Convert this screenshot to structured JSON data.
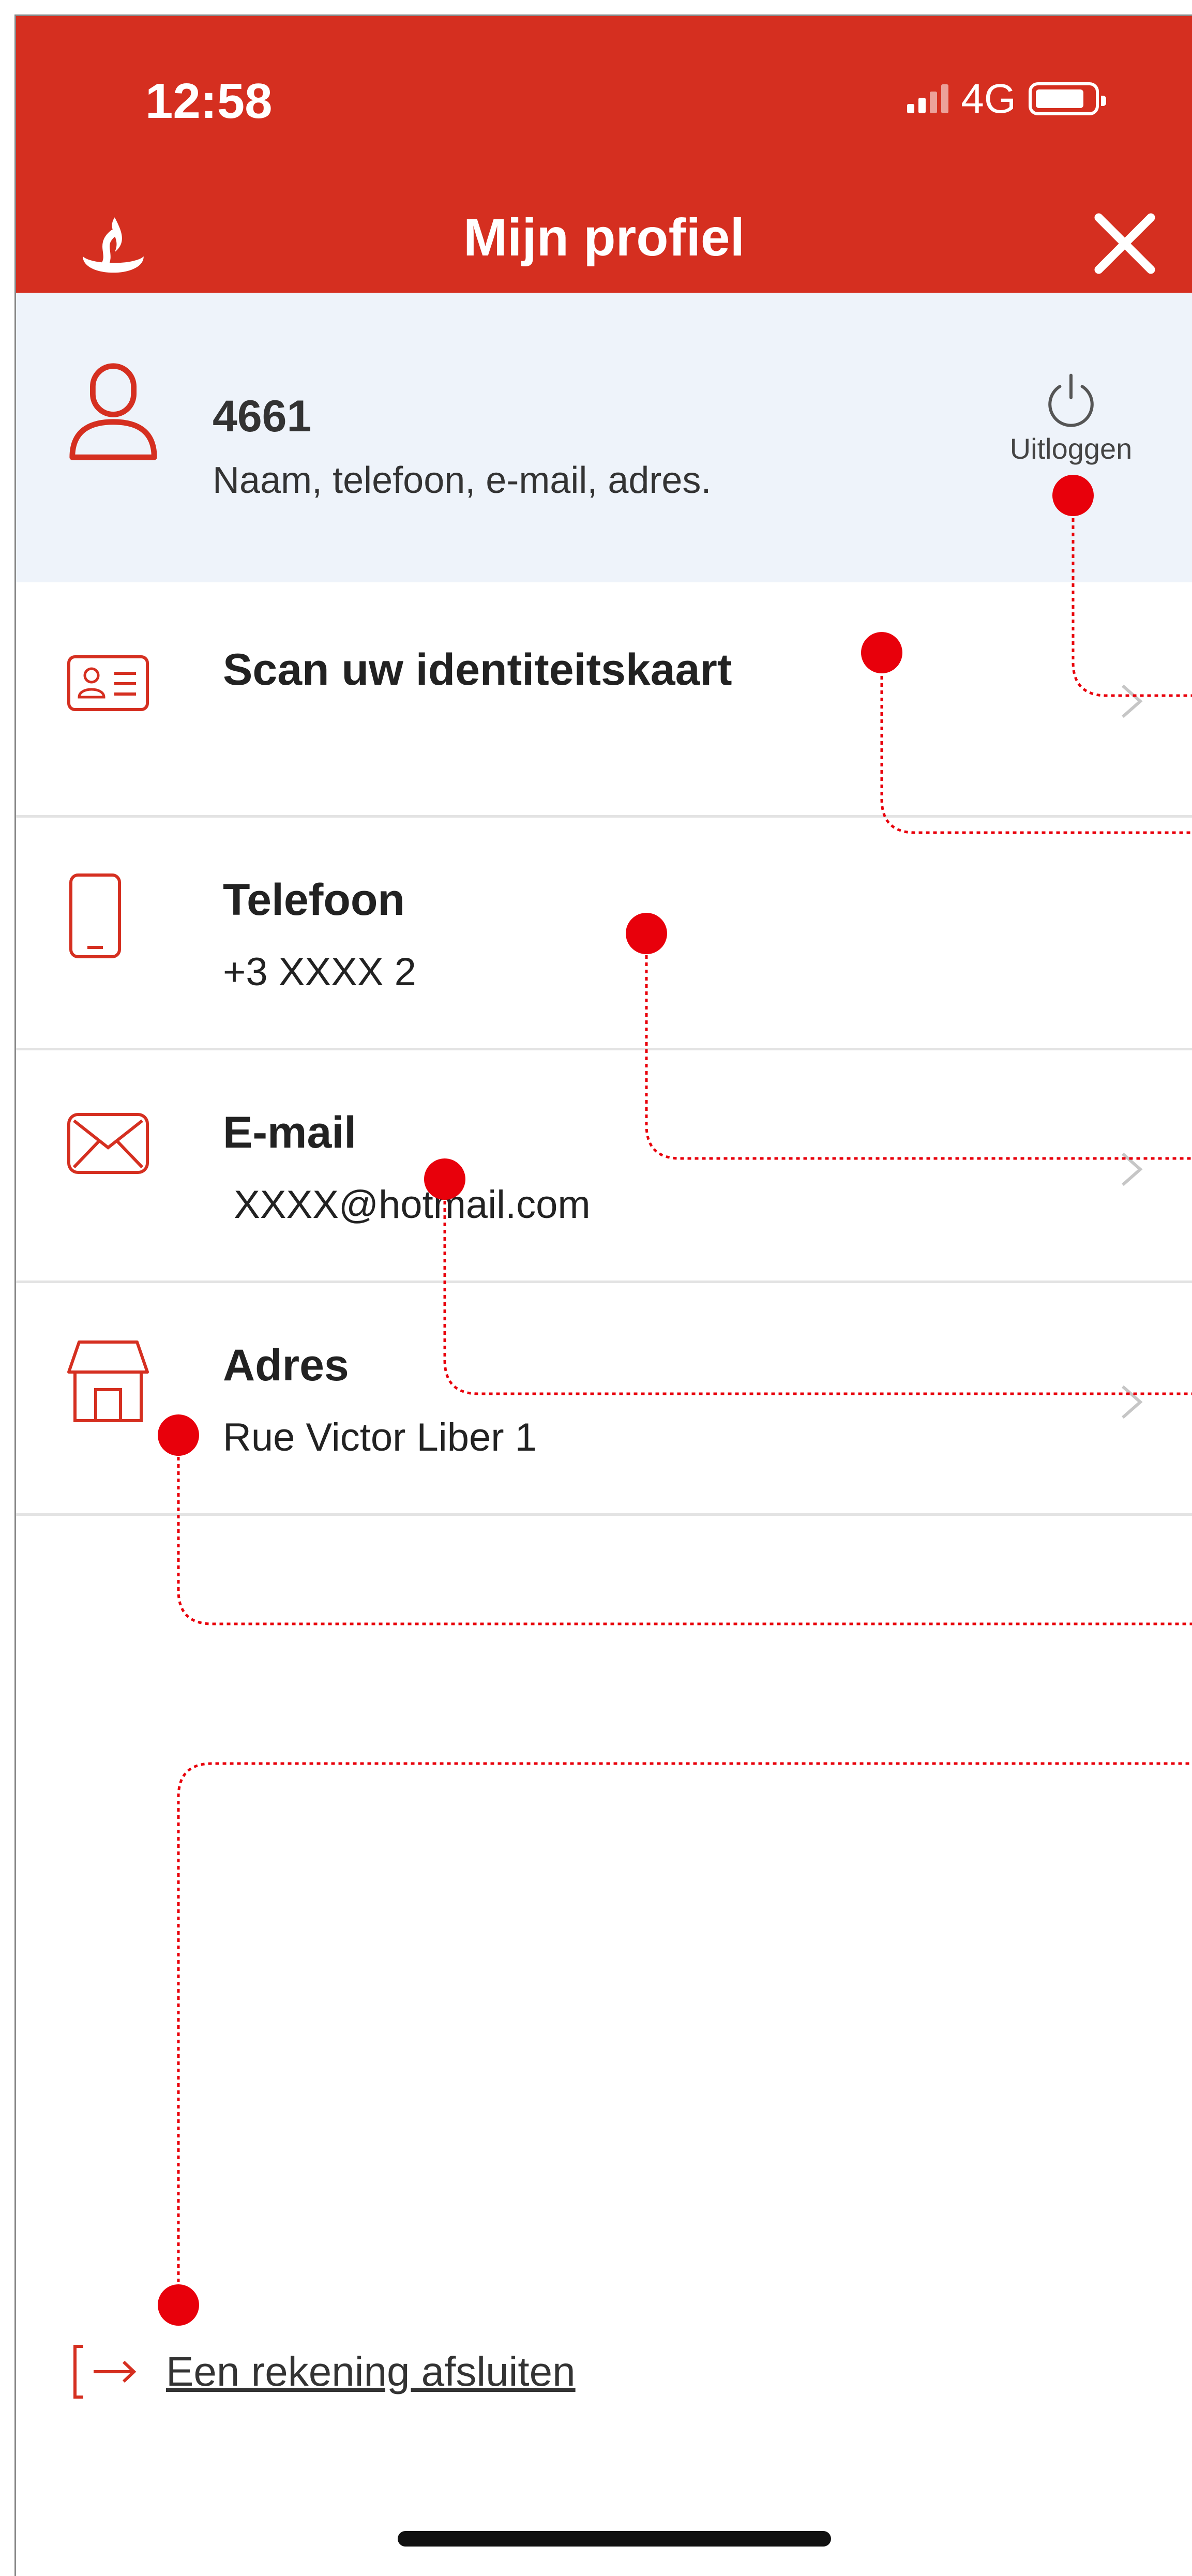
{
  "status": {
    "time": "12:58",
    "network": "4G"
  },
  "header": {
    "title": "Mijn profiel"
  },
  "profile": {
    "number": "4661",
    "subtitle": "Naam, telefoon, e-mail, adres.",
    "logout_label": "Uitloggen"
  },
  "menu": [
    {
      "title": "Scan uw identiteitskaart",
      "value": "",
      "icon": "id-card-icon"
    },
    {
      "title": "Telefoon",
      "value": "+3    XXXX    2",
      "icon": "phone-icon"
    },
    {
      "title": "E-mail",
      "value": " XXXX@hotmail.com",
      "icon": "mail-icon"
    },
    {
      "title": "Adres",
      "value": "Rue Victor Liber 1",
      "icon": "home-icon"
    }
  ],
  "footer": {
    "link_label": "Een rekening afsluiten"
  },
  "colors": {
    "brand": "#d52f20",
    "profile_bg": "#eef3fa",
    "annotation": "#e8000b"
  }
}
